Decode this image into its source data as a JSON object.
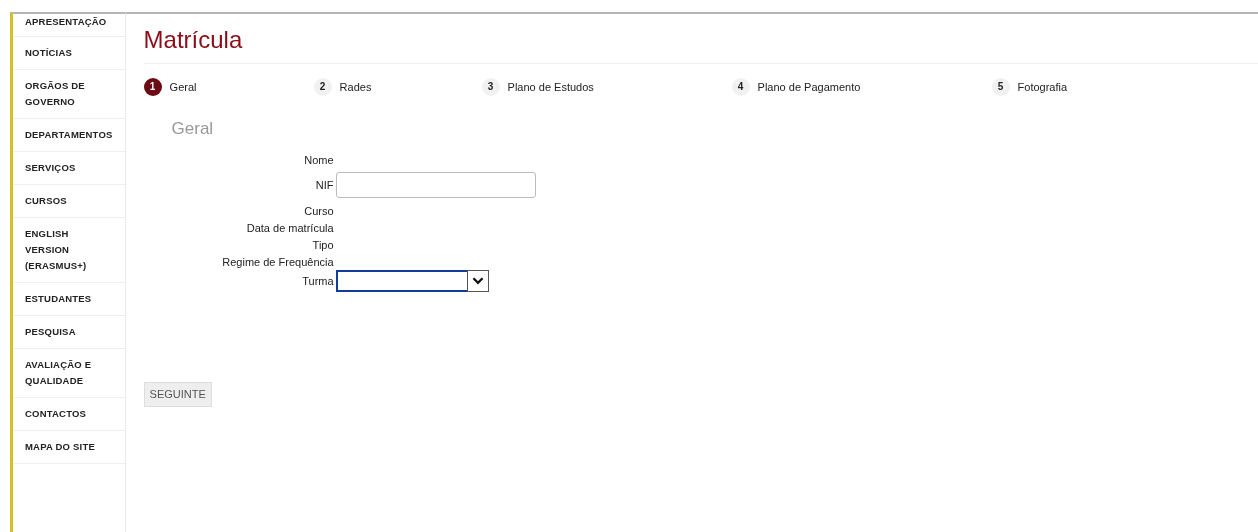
{
  "sidebar": {
    "items": [
      {
        "label": "APRESENTAÇÃO"
      },
      {
        "label": "NOTÍCIAS"
      },
      {
        "label": "ORGÃOS DE GOVERNO"
      },
      {
        "label": "DEPARTAMENTOS"
      },
      {
        "label": "SERVIÇOS"
      },
      {
        "label": "CURSOS"
      },
      {
        "label": "ENGLISH VERSION (ERASMUS+)"
      },
      {
        "label": "ESTUDANTES"
      },
      {
        "label": "PESQUISA"
      },
      {
        "label": "AVALIAÇÃO E QUALIDADE"
      },
      {
        "label": "CONTACTOS"
      },
      {
        "label": "MAPA DO SITE"
      }
    ]
  },
  "page_title": "Matrícula",
  "steps": [
    {
      "number": "1",
      "label": "Geral",
      "selected": true
    },
    {
      "number": "2",
      "label": "Rades",
      "selected": false
    },
    {
      "number": "3",
      "label": "Plano de Estudos",
      "selected": false
    },
    {
      "number": "4",
      "label": "Plano de Pagamento",
      "selected": false
    },
    {
      "number": "5",
      "label": "Fotografia",
      "selected": false
    }
  ],
  "section_title": "Geral",
  "fields": [
    {
      "label": "Nome",
      "kind": "text"
    },
    {
      "label": "NIF",
      "kind": "input"
    },
    {
      "label": "Curso",
      "kind": "text"
    },
    {
      "label": "Data de matrícula",
      "kind": "text"
    },
    {
      "label": "Tipo",
      "kind": "text"
    },
    {
      "label": "Regime de Frequência",
      "kind": "text"
    },
    {
      "label": "Turma",
      "kind": "select"
    }
  ],
  "next_button": "SEGUINTE"
}
